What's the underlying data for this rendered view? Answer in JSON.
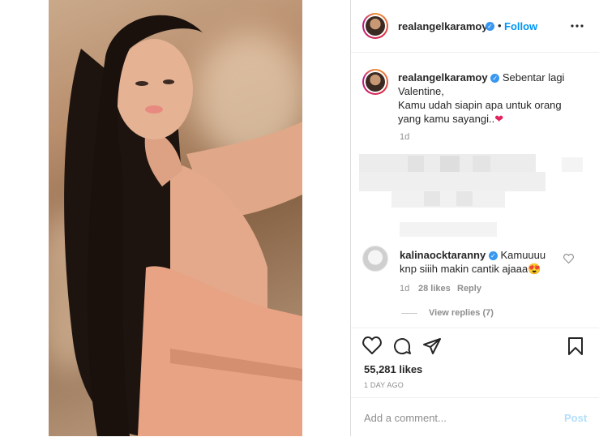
{
  "header": {
    "username": "realangelkaramoy",
    "dot": "•",
    "follow_label": "Follow",
    "more_icon": "more-dots-icon"
  },
  "caption": {
    "username": "realangelkaramoy",
    "line1": "Sebentar lagi",
    "line2": "Valentine,",
    "line3": "Kamu udah siapin apa untuk orang",
    "line4": "yang kamu sayangi..",
    "emoji": "❤",
    "time": "1d"
  },
  "comment": {
    "username": "kalinaocktaranny",
    "text1": "Kamuuuu",
    "text2": "knp siiih makin cantik ajaaa",
    "emoji": "😍",
    "time": "1d",
    "likes": "28 likes",
    "reply_label": "Reply",
    "view_replies": "View replies (7)"
  },
  "actions": {
    "likes": "55,281 likes",
    "timestamp": "1 DAY AGO",
    "icons": [
      "heart-icon",
      "comment-icon",
      "share-icon",
      "bookmark-icon"
    ]
  },
  "add_comment": {
    "placeholder": "Add a comment...",
    "post_label": "Post"
  },
  "colors": {
    "accent": "#0095f6",
    "verified": "#3897f0",
    "muted": "#8e8e8e",
    "dress": "#e8a384"
  }
}
